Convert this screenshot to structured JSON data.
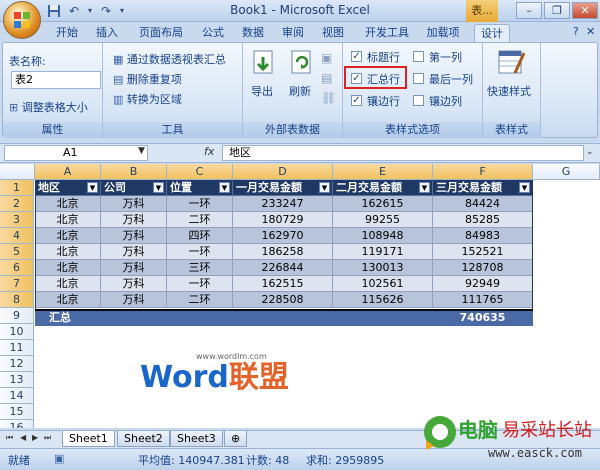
{
  "window": {
    "title": "Book1 - Microsoft Excel",
    "context_tab": "表..."
  },
  "tabs": [
    "开始",
    "插入",
    "页面布局",
    "公式",
    "数据",
    "审阅",
    "视图",
    "开发工具",
    "加载项",
    "设计"
  ],
  "active_tab": "设计",
  "ribbon": {
    "properties": {
      "label": "属性",
      "name_label": "表名称:",
      "name_value": "表2",
      "resize": "调整表格大小"
    },
    "tools": {
      "label": "工具",
      "pivot": "通过数据透视表汇总",
      "remove_dup": "删除重复项",
      "convert": "转换为区域"
    },
    "external": {
      "label": "外部表数据",
      "export": "导出",
      "refresh": "刷新"
    },
    "style_options": {
      "label": "表样式选项",
      "header_row": {
        "text": "标题行",
        "checked": true
      },
      "total_row": {
        "text": "汇总行",
        "checked": true
      },
      "banded_rows": {
        "text": "镶边行",
        "checked": true
      },
      "first_col": {
        "text": "第一列",
        "checked": false
      },
      "last_col": {
        "text": "最后一列",
        "checked": false
      },
      "banded_cols": {
        "text": "镶边列",
        "checked": false
      }
    },
    "styles": {
      "label": "表样式",
      "quick": "快速样式"
    }
  },
  "formula_bar": {
    "name_box": "A1",
    "fx": "fx",
    "content": "地区"
  },
  "columns": [
    "A",
    "B",
    "C",
    "D",
    "E",
    "F",
    "G"
  ],
  "rows": [
    "1",
    "2",
    "3",
    "4",
    "5",
    "6",
    "7",
    "8",
    "9",
    "10",
    "11",
    "12",
    "13",
    "14",
    "15",
    "16"
  ],
  "table": {
    "headers": [
      "地区",
      "公司",
      "位置",
      "一月交易金额",
      "二月交易金额",
      "三月交易金额"
    ],
    "data": [
      [
        "北京",
        "万科",
        "一环",
        "233247",
        "162615",
        "84424"
      ],
      [
        "北京",
        "万科",
        "二环",
        "180729",
        "99255",
        "85285"
      ],
      [
        "北京",
        "万科",
        "四环",
        "162970",
        "108948",
        "84983"
      ],
      [
        "北京",
        "万科",
        "一环",
        "186258",
        "119171",
        "152521"
      ],
      [
        "北京",
        "万科",
        "三环",
        "226844",
        "130013",
        "128708"
      ],
      [
        "北京",
        "万科",
        "一环",
        "162515",
        "102561",
        "92949"
      ],
      [
        "北京",
        "万科",
        "二环",
        "228508",
        "115626",
        "111765"
      ]
    ],
    "total_label": "汇总",
    "total_value": "740635"
  },
  "sheets": [
    "Sheet1",
    "Sheet2",
    "Sheet3"
  ],
  "status": {
    "ready": "就绪",
    "average": "平均值: 140947.381",
    "count": "计数: 48",
    "sum": "求和: 2959895"
  },
  "watermark": {
    "url": "www.wordlm.com",
    "word": "Word",
    "cn": "联盟"
  },
  "site_logo": {
    "cn1": "电脑",
    "cn2": "易采站长站",
    "url": "www.easck.com"
  }
}
